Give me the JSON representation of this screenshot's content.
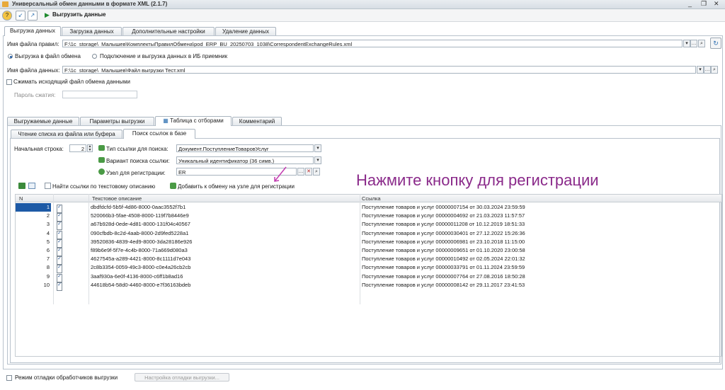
{
  "window": {
    "title": "Универсальный обмен данными в формате XML (2.1.7)",
    "icon": "app-icon"
  },
  "toolbar": {
    "run_label": "Выгрузить данные",
    "icons": [
      "help-icon",
      "open-file-icon",
      "save-file-icon",
      "run-icon"
    ]
  },
  "main_tabs": [
    {
      "label": "Выгрузка данных",
      "active": true
    },
    {
      "label": "Загрузка данных",
      "active": false
    },
    {
      "label": "Дополнительные настройки",
      "active": false
    },
    {
      "label": "Удаление данных",
      "active": false
    }
  ],
  "rules_file": {
    "label": "Имя файла правил:",
    "value": "F:\\1c_storage\\_Малышев\\КомплектыПравилОбмена\\pod_ERP_BU_20250703_1038\\CorrespondentExchangeRules.xml"
  },
  "export_mode": {
    "option1": "Выгрузка в файл обмена",
    "option2": "Подключение и выгрузка данных в ИБ приемник"
  },
  "data_file": {
    "label": "Имя файла данных:",
    "value": "F:\\1c_storage\\_Малышев\\Файл выгрузки Тест.xml"
  },
  "compress": {
    "label": "Сжимать исходящий файл обмена данными"
  },
  "password": {
    "label": "Пароль сжатия:",
    "value": ""
  },
  "sub_tabs": [
    {
      "label": "Выгружаемые данные",
      "active": false
    },
    {
      "label": "Параметры выгрузки",
      "active": false
    },
    {
      "label": "Таблица с отборами",
      "active": true
    },
    {
      "label": "Комментарий",
      "active": false
    }
  ],
  "inner_tabs": [
    {
      "label": "Чтение списка из файла или буфера",
      "active": false
    },
    {
      "label": "Поиск ссылок в базе",
      "active": true
    }
  ],
  "search": {
    "start_row_label": "Начальная строка:",
    "start_row_value": "2",
    "ref_type_label": "Тип ссылки для поиска:",
    "ref_type_value": "Документ.ПоступлениеТоваровУслуг",
    "variant_label": "Вариант поиска ссылки:",
    "variant_value": "Уникальный идентификатор (36 симв.)",
    "node_label": "Узел для регистрации:",
    "node_value": "ER"
  },
  "grid_toolbar": {
    "find_label": "Найти ссылки по текстовому описанию",
    "add_label": "Добавить к обмену на узле для регистрации"
  },
  "annotation": "Нажмите кнопку для регистрации",
  "table": {
    "columns": [
      "N",
      "Текстовое описание",
      "Ссылка"
    ],
    "rows": [
      {
        "n": "1",
        "desc": "dbdfdcfd-5b5f-4d86-8000-0aac3552f7b1",
        "link": "Поступление товаров и услуг 00000007154 от 30.03.2024 23:59:59"
      },
      {
        "n": "2",
        "desc": "520066b3-5fae-4508-8000-119f7b8446e9",
        "link": "Поступление товаров и услуг 00000004692 от 21.03.2023 11:57:57"
      },
      {
        "n": "3",
        "desc": "a67b928d-0ede-4d81-8000-131f04c40567",
        "link": "Поступление товаров и услуг 00000011208 от 10.12.2019 18:51:33"
      },
      {
        "n": "4",
        "desc": "090cfbdb-8c2d-4aab-8000-2d9fed5228a1",
        "link": "Поступление товаров и услуг 00000030401 от 27.12.2022 15:26:36"
      },
      {
        "n": "5",
        "desc": "39520836-4839-4ed9-8000-3da28186e926",
        "link": "Поступление товаров и услуг 00000006981 от 23.10.2018 11:15:00"
      },
      {
        "n": "6",
        "desc": "f89b6e9f-5f7e-4c4b-8000-71a669d080a3",
        "link": "Поступление товаров и услуг 00000009651 от 01.10.2020 23:00:58"
      },
      {
        "n": "7",
        "desc": "4627545a-a289-4421-8000-8c1111d7e043",
        "link": "Поступление товаров и услуг 00000010492 от 02.05.2024 22:01:32"
      },
      {
        "n": "8",
        "desc": "2c8b3354-0059-49c3-8000-c0e4a26cb2cb",
        "link": "Поступление товаров и услуг 00000033791 от 01.11.2024 23:59:59"
      },
      {
        "n": "9",
        "desc": "3aaf930a-6e0f-4136-8000-c6ff1b8ad16",
        "link": "Поступление товаров и услуг 00000007764 от 27.08.2016 18:50:28"
      },
      {
        "n": "10",
        "desc": "44618b54-58d0-4460-8000-e7f36163bdeb",
        "link": "Поступление товаров и услуг 00000008142 от 29.11.2017 23:41:53"
      }
    ]
  },
  "footer": {
    "debug_label": "Режим отладки обработчиков выгрузки",
    "debug_settings": "Настройка отладки выгрузки..."
  }
}
